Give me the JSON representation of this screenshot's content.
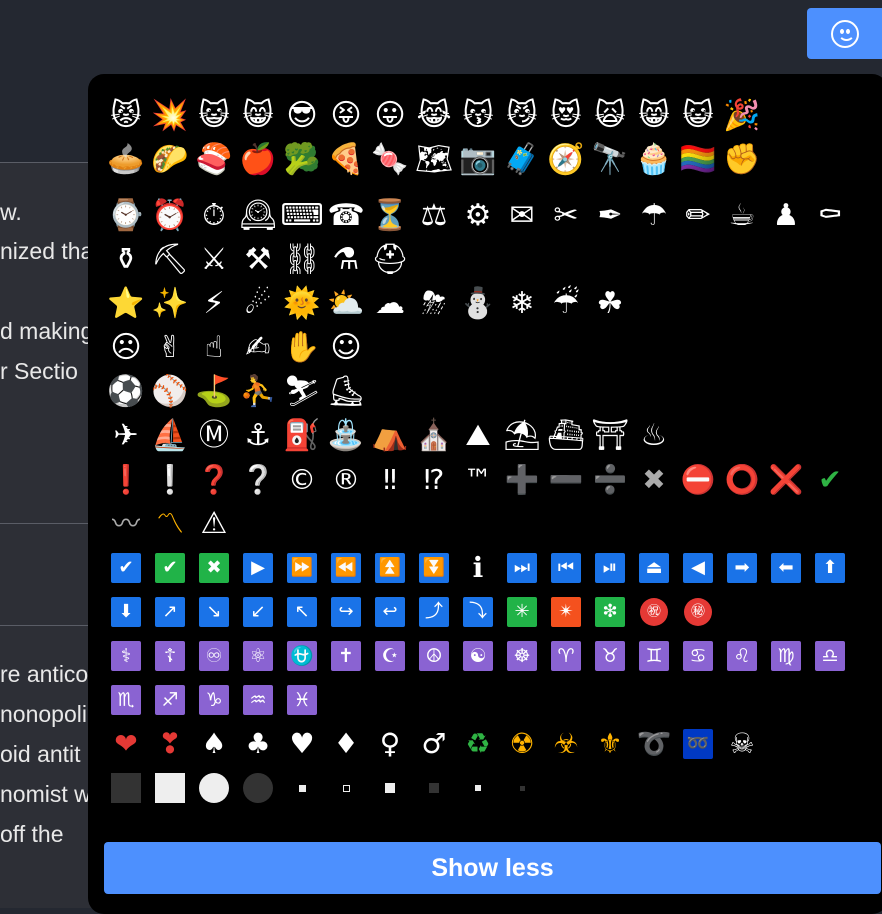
{
  "article": {
    "lines": [
      "w.",
      "nized tha",
      "",
      "d making",
      "r Sectio"
    ],
    "lines2": [
      "re antico",
      "nonopoli",
      "oid antit",
      "nomist w",
      " off the"
    ]
  },
  "picker": {
    "rows": [
      [
        "😾",
        "💥",
        "😺",
        "😸",
        "😎",
        "😝",
        "😛",
        "😹",
        "😽",
        "😼",
        "😻",
        "🙀",
        "😸",
        "😺",
        "🎉"
      ],
      [
        "🥧",
        "🌮",
        "🍣",
        "🍎",
        "🥦",
        "🍕",
        "🍬",
        "🗺",
        "📷",
        "🧳",
        "🧭",
        "🔭",
        "🧁",
        "🏳‍🌈",
        "✊"
      ],
      [
        "⌚",
        "⏰",
        "⏱",
        "🕰",
        "⌨",
        "☎",
        "⏳",
        "⚖",
        "⚙",
        "✉",
        "✂",
        "✒",
        "☂",
        "✏",
        "☕",
        "♟",
        "⚰"
      ],
      [
        "⚱",
        "⛏",
        "⚔",
        "⚒",
        "⛓",
        "⚗",
        "⛑"
      ],
      [
        "⭐",
        "✨",
        "⚡",
        "☄",
        "🌞",
        "⛅",
        "☁",
        "⛈",
        "⛄",
        "❄",
        "☔",
        "☘"
      ],
      [
        "☹",
        "✌",
        "☝",
        "✍",
        "✋",
        "☺"
      ],
      [
        "⚽",
        "⚾",
        "⛳",
        "⛹",
        "⛷",
        "⛸"
      ],
      [
        "✈",
        "⛵",
        "Ⓜ",
        "⚓",
        "⛽",
        "⛲",
        "⛺",
        "⛪",
        "⛰",
        "⛱",
        "⛴",
        "⛩",
        "♨"
      ],
      [
        "❗",
        "❕",
        "❓",
        "❔",
        "©",
        "®",
        "‼",
        "⁉",
        "™",
        "➕",
        "➖",
        "➗",
        "✖",
        "⛔",
        "⭕",
        "❌",
        "✔"
      ],
      [
        "〰",
        "〽",
        "⚠"
      ]
    ],
    "blue_row_1": [
      "✔",
      "✔",
      "✖",
      "▶",
      "⏩",
      "⏪",
      "⏫",
      "⏬",
      "ℹ",
      "⏭",
      "⏮",
      "⏯",
      "⏏",
      "◀",
      "➡",
      "⬅",
      "⬆"
    ],
    "blue_row_2": [
      "⬇",
      "↗",
      "↘",
      "↙",
      "↖",
      "↪",
      "↩",
      "⤴",
      "⤵",
      "✳",
      "✴",
      "❇",
      "㊗",
      "㊙"
    ],
    "purple_row_1": [
      "⚕",
      "☦",
      "♾",
      "⚛",
      "⛎",
      "✝",
      "☪",
      "☮",
      "☯",
      "☸",
      "♈",
      "♉",
      "♊",
      "♋",
      "♌",
      "♍",
      "♎"
    ],
    "purple_row_2": [
      "♏",
      "♐",
      "♑",
      "♒",
      "♓"
    ],
    "misc_row": [
      "❤",
      "❣",
      "♠",
      "♣",
      "♥",
      "♦",
      "♀",
      "♂",
      "♻",
      "☢",
      "☣",
      "⚜",
      "➰",
      "➿",
      "☠"
    ],
    "show_less_label": "Show less"
  },
  "colors": {
    "accent": "#4d90fe",
    "panel": "#000000",
    "page_bg": "#242831"
  }
}
